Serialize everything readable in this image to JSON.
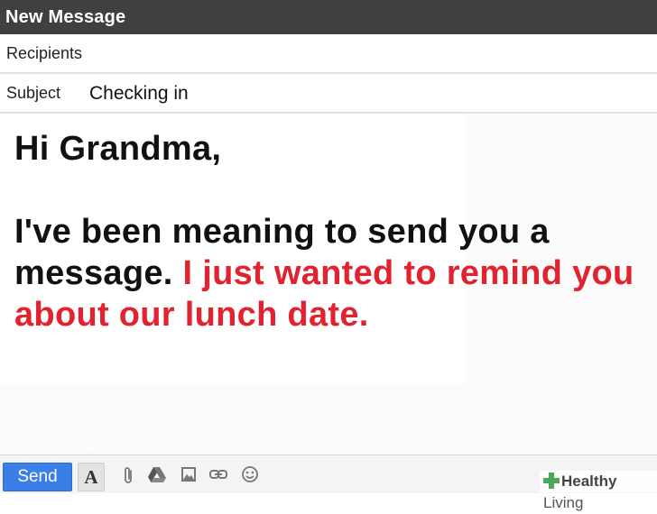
{
  "window": {
    "title": "New Message"
  },
  "fields": {
    "recipients_label": "Recipients",
    "subject_label": "Subject",
    "subject_value": "Checking in"
  },
  "body": {
    "greeting": "Hi Grandma,",
    "line_black": "I've been meaning to send you a message.",
    "line_red": "I just wanted to remind you about our lunch date."
  },
  "toolbar": {
    "send_label": "Send",
    "format_label": "A",
    "icons": [
      "formatting-icon",
      "attach-icon",
      "drive-icon",
      "photo-icon",
      "link-icon",
      "emoji-icon"
    ]
  },
  "colors": {
    "title_bar": "#404040",
    "send_button": "#3a7ee8",
    "highlight_text": "#e2232f",
    "watermark_green": "#4ea65a"
  },
  "watermark": {
    "word1": "Healthy",
    "word2": "Living"
  }
}
